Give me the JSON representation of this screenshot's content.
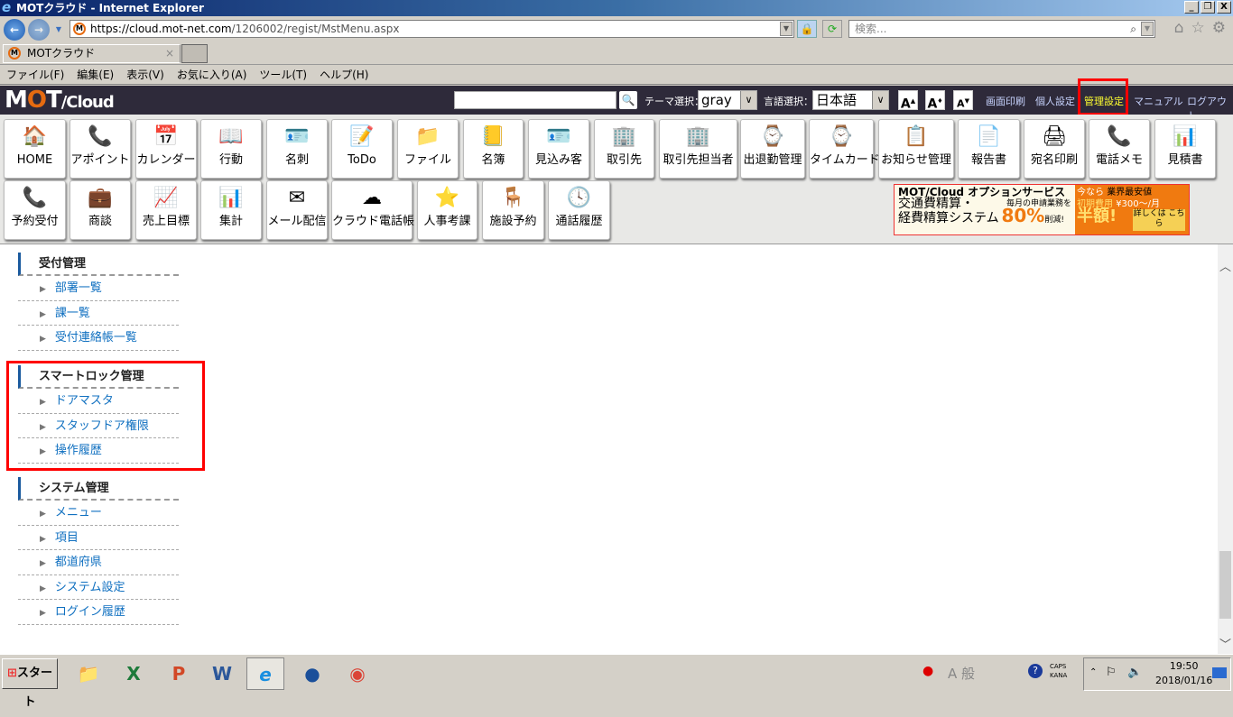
{
  "window": {
    "title": "MOTクラウド - Internet Explorer",
    "controls": [
      "_",
      "❐",
      "X"
    ]
  },
  "browser": {
    "url_host": "https://cloud.mot-net.com",
    "url_path": "/1206002/regist/MstMenu.aspx",
    "search_placeholder": "検索...",
    "tab_title": "MOTクラウド",
    "tab_close": "×"
  },
  "menu": [
    "ファイル(F)",
    "編集(E)",
    "表示(V)",
    "お気に入り(A)",
    "ツール(T)",
    "ヘルプ(H)"
  ],
  "header": {
    "logo_mot_m": "M",
    "logo_mot_o": "O",
    "logo_mot_t": "T",
    "logo_cloud": "/Cloud",
    "theme_label": "テーマ選択：",
    "theme_value": "gray",
    "lang_label": "言語選択：",
    "lang_value": "日本語",
    "font_buttons": [
      "A",
      "A",
      "A"
    ],
    "links": [
      "画面印刷",
      "個人設定",
      "管理設定",
      "マニュアル",
      "ログアウト"
    ],
    "active_link": "管理設定",
    "accent": "#ffff30"
  },
  "apps_row1": [
    {
      "label": "HOME",
      "icon": "🏠"
    },
    {
      "label": "アポイント",
      "icon": "📞"
    },
    {
      "label": "カレンダー",
      "icon": "📅"
    },
    {
      "label": "行動",
      "icon": "📖"
    },
    {
      "label": "名刺",
      "icon": "🪪"
    },
    {
      "label": "ToDo",
      "icon": "📝"
    },
    {
      "label": "ファイル",
      "icon": "📁"
    },
    {
      "label": "名簿",
      "icon": "📒"
    },
    {
      "label": "見込み客",
      "icon": "🪪"
    },
    {
      "label": "取引先",
      "icon": "🏢"
    },
    {
      "label": "取引先担当者",
      "icon": "🏢"
    },
    {
      "label": "出退勤管理",
      "icon": "⌚"
    },
    {
      "label": "タイムカード",
      "icon": "⌚"
    },
    {
      "label": "お知らせ管理",
      "icon": "📋"
    },
    {
      "label": "報告書",
      "icon": "📄"
    },
    {
      "label": "宛名印刷",
      "icon": "🖨"
    },
    {
      "label": "電話メモ",
      "icon": "📞"
    },
    {
      "label": "見積書",
      "icon": "📊"
    }
  ],
  "apps_row2": [
    {
      "label": "予約受付",
      "icon": "📞"
    },
    {
      "label": "商談",
      "icon": "💼"
    },
    {
      "label": "売上目標",
      "icon": "📈"
    },
    {
      "label": "集計",
      "icon": "📊"
    },
    {
      "label": "メール配信",
      "icon": "✉"
    },
    {
      "label": "クラウド電話帳",
      "icon": "☁"
    },
    {
      "label": "人事考課",
      "icon": "⭐"
    },
    {
      "label": "施設予約",
      "icon": "🪑"
    },
    {
      "label": "通話履歴",
      "icon": "🕓"
    }
  ],
  "banner": {
    "brand": "MOT/Cloud オプションサービス",
    "line1": "交通費精算・",
    "line2": "経費精算システム",
    "sub": "毎月の申請業務を",
    "pct": "80%",
    "cut": "削減!",
    "now": "今なら",
    "initial": "初期費用",
    "half": "半額!",
    "cheapest": "業界最安値",
    "price": "¥300〜/月",
    "details": "詳しくは こちら"
  },
  "sections": [
    {
      "title": "受付管理",
      "items": [
        "部署一覧",
        "課一覧",
        "受付連絡帳一覧"
      ]
    },
    {
      "title": "スマートロック管理",
      "items": [
        "ドアマスタ",
        "スタッフドア権限",
        "操作履歴"
      ]
    },
    {
      "title": "システム管理",
      "items": [
        "メニュー",
        "項目",
        "都道府県",
        "システム設定",
        "ログイン履歴"
      ]
    }
  ],
  "taskbar": {
    "start": "スタート",
    "ime": "A 般",
    "caps": "CAPS",
    "kana": "KANA",
    "time": "19:50",
    "date": "2018/01/16"
  }
}
